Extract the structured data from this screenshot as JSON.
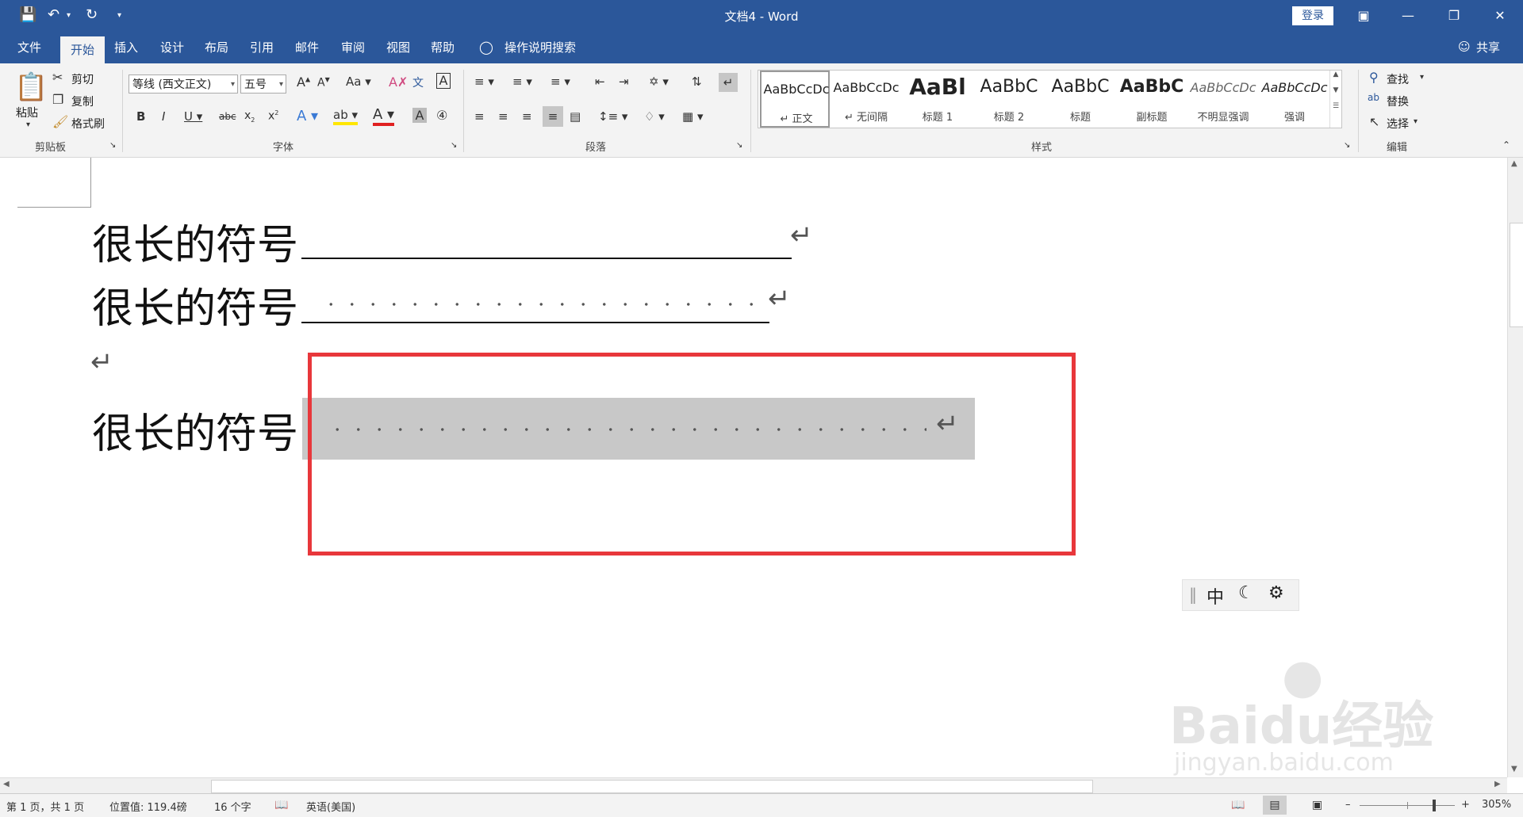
{
  "titlebar": {
    "doc_title": "文档4 - Word",
    "login": "登录"
  },
  "menu": {
    "tabs": [
      "文件",
      "开始",
      "插入",
      "设计",
      "布局",
      "引用",
      "邮件",
      "审阅",
      "视图",
      "帮助"
    ],
    "active_tab": "开始",
    "tell_me": "操作说明搜索",
    "share": "共享"
  },
  "ribbon": {
    "clipboard": {
      "paste": "粘贴",
      "cut": "剪切",
      "copy": "复制",
      "format_painter": "格式刷",
      "label": "剪贴板"
    },
    "font": {
      "font_name": "等线 (西文正文)",
      "font_size": "五号",
      "label": "字体"
    },
    "paragraph": {
      "label": "段落"
    },
    "styles": {
      "label": "样式",
      "items": [
        {
          "preview": "AaBbCcDc",
          "name": "正文"
        },
        {
          "preview": "AaBbCcDc",
          "name": "无间隔"
        },
        {
          "preview": "AaBl",
          "name": "标题 1"
        },
        {
          "preview": "AaBbC",
          "name": "标题 2"
        },
        {
          "preview": "AaBbC",
          "name": "标题"
        },
        {
          "preview": "AaBbC",
          "name": "副标题"
        },
        {
          "preview": "AaBbCcDc",
          "name": "不明显强调"
        },
        {
          "preview": "AaBbCcDc",
          "name": "强调"
        }
      ]
    },
    "editing": {
      "find": "查找",
      "replace": "替换",
      "select": "选择",
      "label": "编辑"
    }
  },
  "document": {
    "line1": "很长的符号",
    "line2": "很长的符号",
    "line3": "很长的符号"
  },
  "ime": {
    "mode": "中"
  },
  "status": {
    "page": "第 1 页，共 1 页",
    "position": "位置值: 119.4磅",
    "words": "16 个字",
    "language": "英语(美国)",
    "zoom": "305%"
  },
  "colors": {
    "brand": "#2b579a",
    "annotation": "#e8373b",
    "selection": "#c8c8c8"
  },
  "watermark": {
    "line1": "Baidu经验",
    "line2": "jingyan.baidu.com"
  }
}
